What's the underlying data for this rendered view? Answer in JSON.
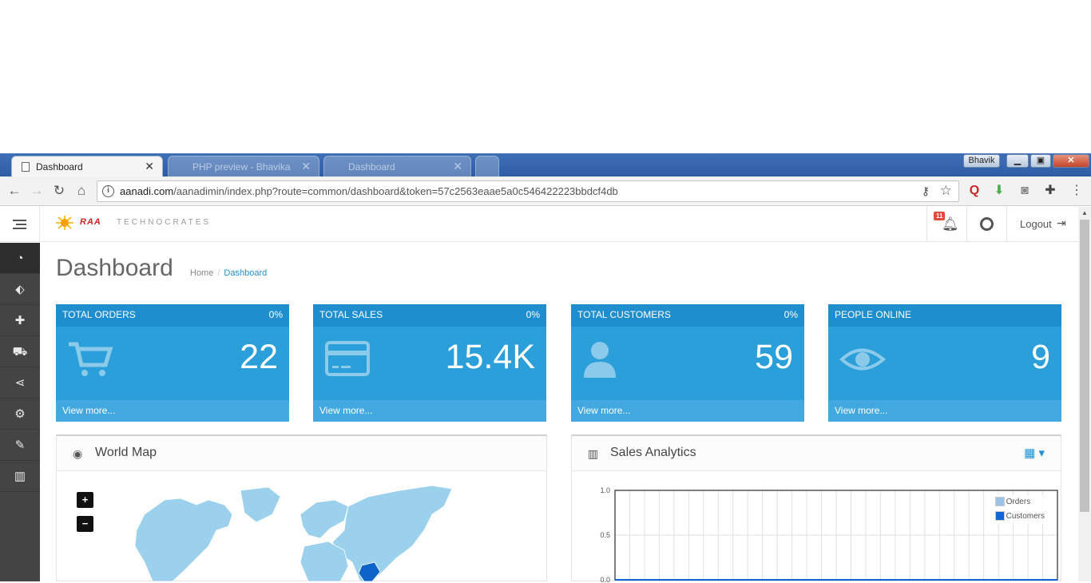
{
  "browser": {
    "active_tab": {
      "title": "Dashboard"
    },
    "inactive_tabs": [
      {
        "title": "PHP preview - Bhavika"
      },
      {
        "title": "Dashboard"
      }
    ],
    "profile_name": "Bhavik",
    "url_host": "aanadi.com",
    "url_path": "/aanadimin/index.php?route=common/dashboard&token=57c2563eaae5a0c546422223bbdcf4db"
  },
  "header": {
    "logo_brand": "RAA",
    "logo_tagline": "TECHNOCRATES",
    "notification_count": "11",
    "logout_label": "Logout"
  },
  "sidebar": {
    "items": [
      {
        "icon": "dashboard-icon",
        "glyph": "◔",
        "active": true
      },
      {
        "icon": "tags-icon",
        "glyph": "⬖"
      },
      {
        "icon": "puzzle-icon",
        "glyph": "✚"
      },
      {
        "icon": "cart-icon",
        "glyph": "⛟"
      },
      {
        "icon": "share-icon",
        "glyph": "⋖"
      },
      {
        "icon": "cog-icon",
        "glyph": "⚙"
      },
      {
        "icon": "wrench-icon",
        "glyph": "✎"
      },
      {
        "icon": "bar-chart-icon",
        "glyph": "▥"
      }
    ]
  },
  "page": {
    "title": "Dashboard",
    "breadcrumb": [
      "Home",
      "Dashboard"
    ]
  },
  "tiles": [
    {
      "heading": "Total Orders",
      "percent": "0%",
      "value": "22",
      "link": "View more...",
      "icon": "cart-icon"
    },
    {
      "heading": "Total Sales",
      "percent": "0%",
      "value": "15.4K",
      "link": "View more...",
      "icon": "credit-card-icon"
    },
    {
      "heading": "Total Customers",
      "percent": "0%",
      "value": "59",
      "link": "View more...",
      "icon": "user-icon"
    },
    {
      "heading": "People Online",
      "percent": "",
      "value": "9",
      "link": "View more...",
      "icon": "eye-icon"
    }
  ],
  "world_map": {
    "title": "World Map",
    "zoom_in": "+",
    "zoom_out": "−"
  },
  "sales_analytics": {
    "title": "Sales Analytics",
    "legend": [
      "Orders",
      "Customers"
    ]
  },
  "colors": {
    "tile": "#2b9fd9",
    "tile_head": "#1f8ecf",
    "sidebar": "#444444",
    "link": "#1e91cf",
    "map_land": "#9cd1ee",
    "map_highlight": "#0d63c9",
    "orders": "#9cc3e5",
    "customers": "#1065d4"
  },
  "chart_data": {
    "type": "line",
    "title": "",
    "series": [
      {
        "name": "Orders",
        "values": [
          0,
          0,
          0,
          0,
          0,
          0,
          0,
          0,
          0,
          0,
          0,
          0,
          0,
          0,
          0,
          0,
          0,
          0,
          0,
          0,
          0,
          0,
          0,
          0,
          0,
          0,
          0,
          0,
          0,
          0,
          0
        ]
      },
      {
        "name": "Customers",
        "values": [
          0,
          0,
          0,
          0,
          0,
          0,
          0,
          0,
          0,
          0,
          0,
          0,
          0,
          0,
          0,
          0,
          0,
          0,
          0,
          0,
          0,
          0,
          0,
          0,
          0,
          0,
          0,
          0,
          0,
          0,
          0
        ]
      }
    ],
    "ylim": [
      0,
      1.0
    ],
    "yticks": [
      "1.0",
      "0.5",
      "0.0"
    ],
    "grid": true,
    "legend_position": "top-right"
  }
}
